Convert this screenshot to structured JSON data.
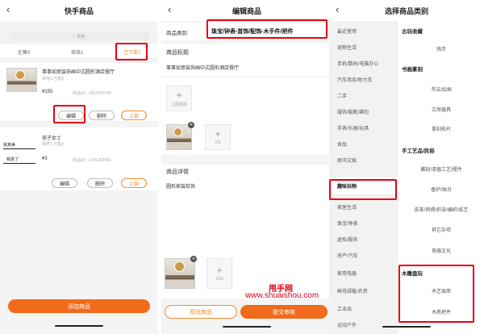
{
  "panel1": {
    "title": "快手商品",
    "search_placeholder": "搜索",
    "tabs": [
      "在售0",
      "审核1",
      "已下架2"
    ],
    "product1": {
      "name": "事事如意装饰画中式圆形酒店餐厅",
      "meta1": "库存1 已售0",
      "price": "¥155",
      "meta2": "商品ID：2424367728"
    },
    "product1_buttons": [
      "编辑",
      "删除",
      "上架"
    ],
    "product2": {
      "name": "孩子女士",
      "meta1": "库存1 已售0",
      "price": "¥3",
      "meta2": "商品ID：2141269491"
    },
    "product2_thumb": [
      "我真美",
      "我变了"
    ],
    "product2_buttons": [
      "编辑",
      "删除",
      "上架"
    ],
    "add_button": "添加商品"
  },
  "panel2": {
    "title": "编辑商品",
    "category_label": "商品类别",
    "category_value": "珠宝/钟表-首饰/配饰-木手件/把件",
    "title_label": "商品标题",
    "title_value": "事事如意装饰画中式圆形酒店餐厅",
    "video_label": "主图视频",
    "image_count": "1/9",
    "detail_label": "商品详情",
    "detail_value": "圆形家装软饰",
    "detail_count": "1/20",
    "preview_button": "预览商品",
    "submit_button": "提交审核"
  },
  "panel3": {
    "title": "选择商品类别",
    "left_categories": [
      "最近使用",
      "宠物生活",
      "手机/数码/电脑办公",
      "汽车用品/助力车",
      "二手",
      "服饰/鞋靴/箱包",
      "手表/乐器/玩具",
      "食品",
      "图书文娱",
      "趣味玩物",
      "家居生活",
      "珠宝/钟表",
      "虚拟/服务",
      "房产/汽车",
      "家用电器",
      "鲜花绿植/农资",
      "工业品",
      "运动户外"
    ],
    "selected_category": "趣味玩物",
    "groups": [
      {
        "heading": "古玩收藏",
        "items": [
          "钱币"
        ]
      },
      {
        "heading": "书画篆刻",
        "items": [
          "书法/绘画",
          "文房器具",
          "篆刻拓片"
        ]
      },
      {
        "heading": "手工艺品/民俗",
        "items": [
          "雕刻/漆器工艺/摆件",
          "香炉/烛台",
          "皮革/刺绣/织染/编织/纸艺",
          "其它杂项",
          "茶器文化"
        ]
      },
      {
        "heading": "木雕盘玩",
        "items": [
          "木艺珠串",
          "木质把件"
        ]
      }
    ]
  },
  "watermark": {
    "line1": "甩手网",
    "line2": "www.shuaishou.com"
  },
  "colors": {
    "accent": "#f28b2d",
    "highlight": "#e60012",
    "watermark": "#d9001b"
  }
}
